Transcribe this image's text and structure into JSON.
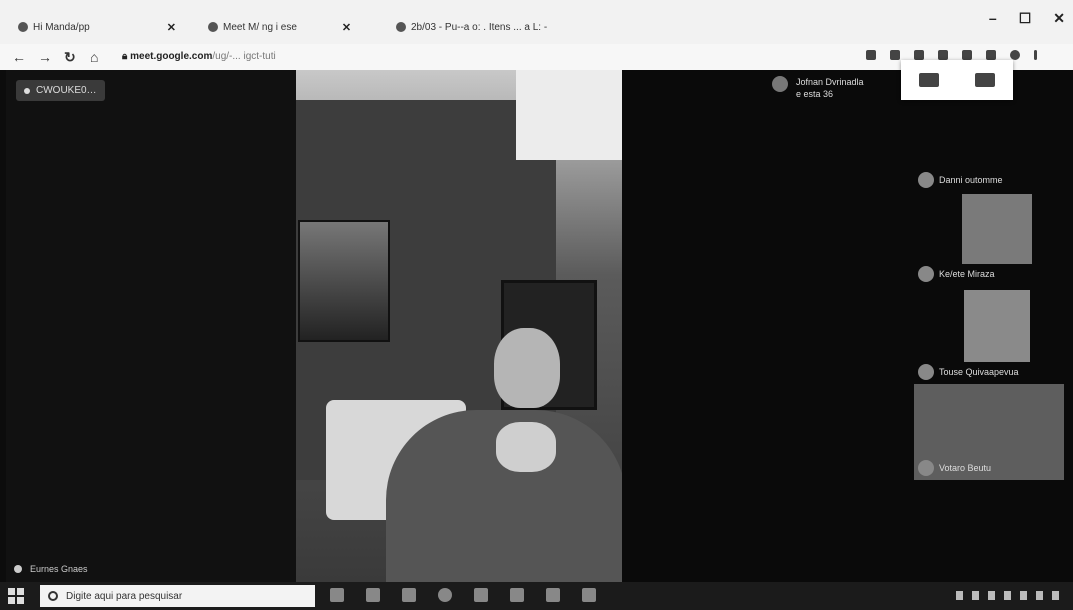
{
  "browser": {
    "tabs": [
      {
        "label": "Hi Manda/pp"
      },
      {
        "label": "Meet M/ ng i ese"
      },
      {
        "label": "2b/03 - Pu--a o: . Itens ... a L: -"
      }
    ],
    "address": {
      "domain": "meet.google.com",
      "path": "/ug/-... igct-tuti"
    },
    "window_controls": [
      "–",
      "☐",
      "✕"
    ]
  },
  "meet": {
    "caption_badge": "CWOUKE0…",
    "presenter": {
      "line1": "Jofnan Dvrinadla",
      "line2": "e esta 36"
    },
    "participants": [
      {
        "name": "Danni outomme"
      },
      {
        "name": "Ke/ete Miraza"
      },
      {
        "name": "Touse Quivaapevua"
      },
      {
        "name": "Votaro Beutu"
      }
    ],
    "self_name": "Eurnes Gnaes"
  },
  "taskbar": {
    "search_placeholder": "Digite aqui para pesquisar"
  }
}
